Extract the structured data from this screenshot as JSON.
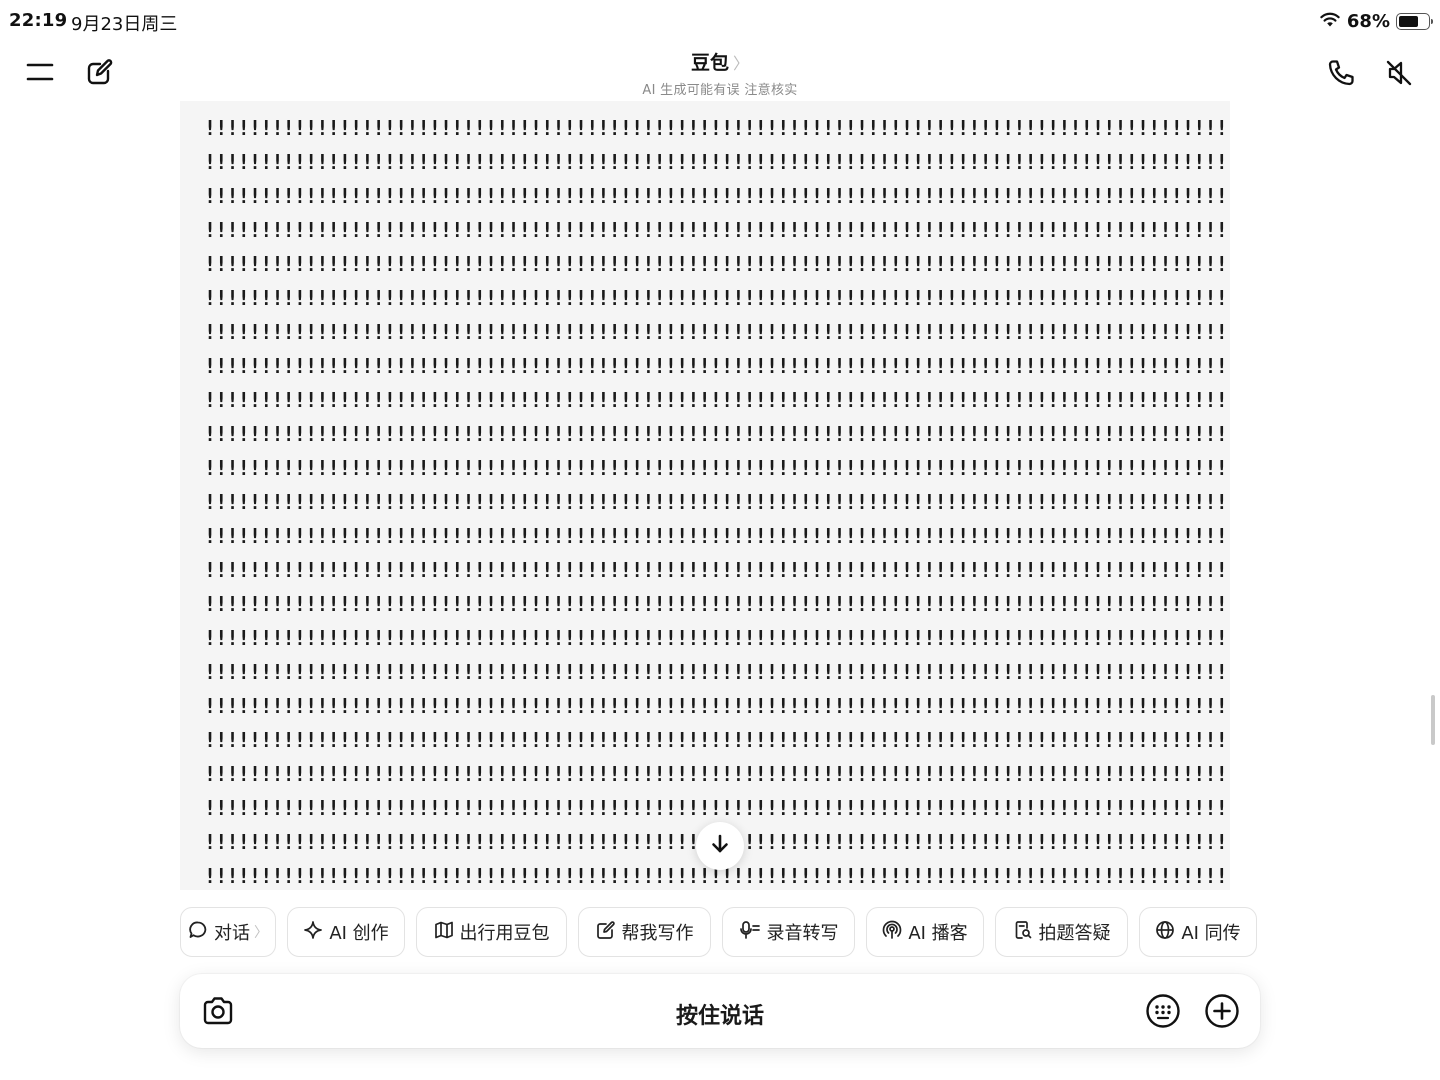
{
  "status_bar": {
    "time": "22:19",
    "date": "9月23日周三",
    "battery_percent_label": "68%",
    "battery_level": 0.68,
    "icons": [
      "wifi-icon",
      "battery-icon"
    ]
  },
  "header": {
    "title": "豆包",
    "title_chevron": "〉",
    "subtitle": "AI 生成可能有误 注意核实",
    "left_icons": [
      "menu-icon",
      "new-chat-icon"
    ],
    "right_icons": [
      "phone-icon",
      "speaker-muted-icon"
    ]
  },
  "message": {
    "line_text": "!!!!!!!!!!!!!!!!!!!!!!!!!!!!!!!!!!!!!!!!!!!!!!!!!!!!!!!!!!!!!!!!!!!!!!!!!!!!!!!!!!!!!!!!!!!!!!!!!!!!!",
    "line_count": 23
  },
  "scroll_button_icon": "arrow-down-icon",
  "skills": [
    {
      "label": "对话",
      "icon": "chat-bubble-icon",
      "chevron": "〉"
    },
    {
      "label": "AI 创作",
      "icon": "sparkle-icon"
    },
    {
      "label": "出行用豆包",
      "icon": "map-icon"
    },
    {
      "label": "帮我写作",
      "icon": "edit-icon"
    },
    {
      "label": "录音转写",
      "icon": "mic-text-icon"
    },
    {
      "label": "AI 播客",
      "icon": "podcast-icon"
    },
    {
      "label": "拍题答疑",
      "icon": "doc-search-icon"
    },
    {
      "label": "AI 同传",
      "icon": "globe-icon"
    }
  ],
  "composer": {
    "hold_to_talk_label": "按住说话",
    "icons": [
      "camera-icon",
      "keyboard-icon",
      "add-icon"
    ]
  }
}
